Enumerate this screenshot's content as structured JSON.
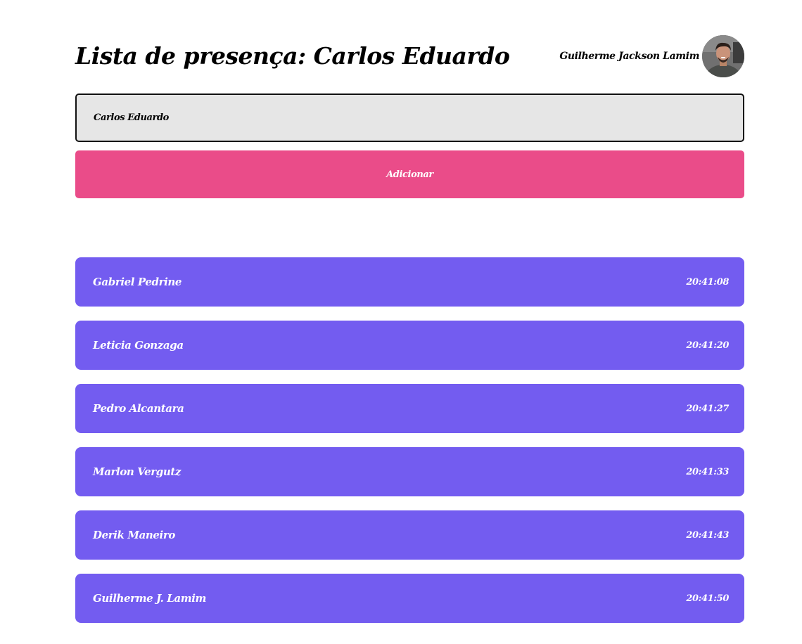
{
  "header": {
    "title": "Lista de presença: Carlos Eduardo",
    "user_name": "Guilherme Jackson Lamim",
    "avatar_icon": "user-avatar-photo"
  },
  "form": {
    "input_value": "Carlos Eduardo",
    "add_label": "Adicionar"
  },
  "colors": {
    "button": "#ea4c89",
    "card": "#735cf0",
    "input_bg": "#e6e6e6"
  },
  "attendees": [
    {
      "name": "Gabriel Pedrine",
      "time": "20:41:08"
    },
    {
      "name": "Leticia Gonzaga",
      "time": "20:41:20"
    },
    {
      "name": "Pedro Alcantara",
      "time": "20:41:27"
    },
    {
      "name": "Marlon Vergutz",
      "time": "20:41:33"
    },
    {
      "name": "Derik Maneiro",
      "time": "20:41:43"
    },
    {
      "name": "Guilherme J. Lamim",
      "time": "20:41:50"
    }
  ]
}
